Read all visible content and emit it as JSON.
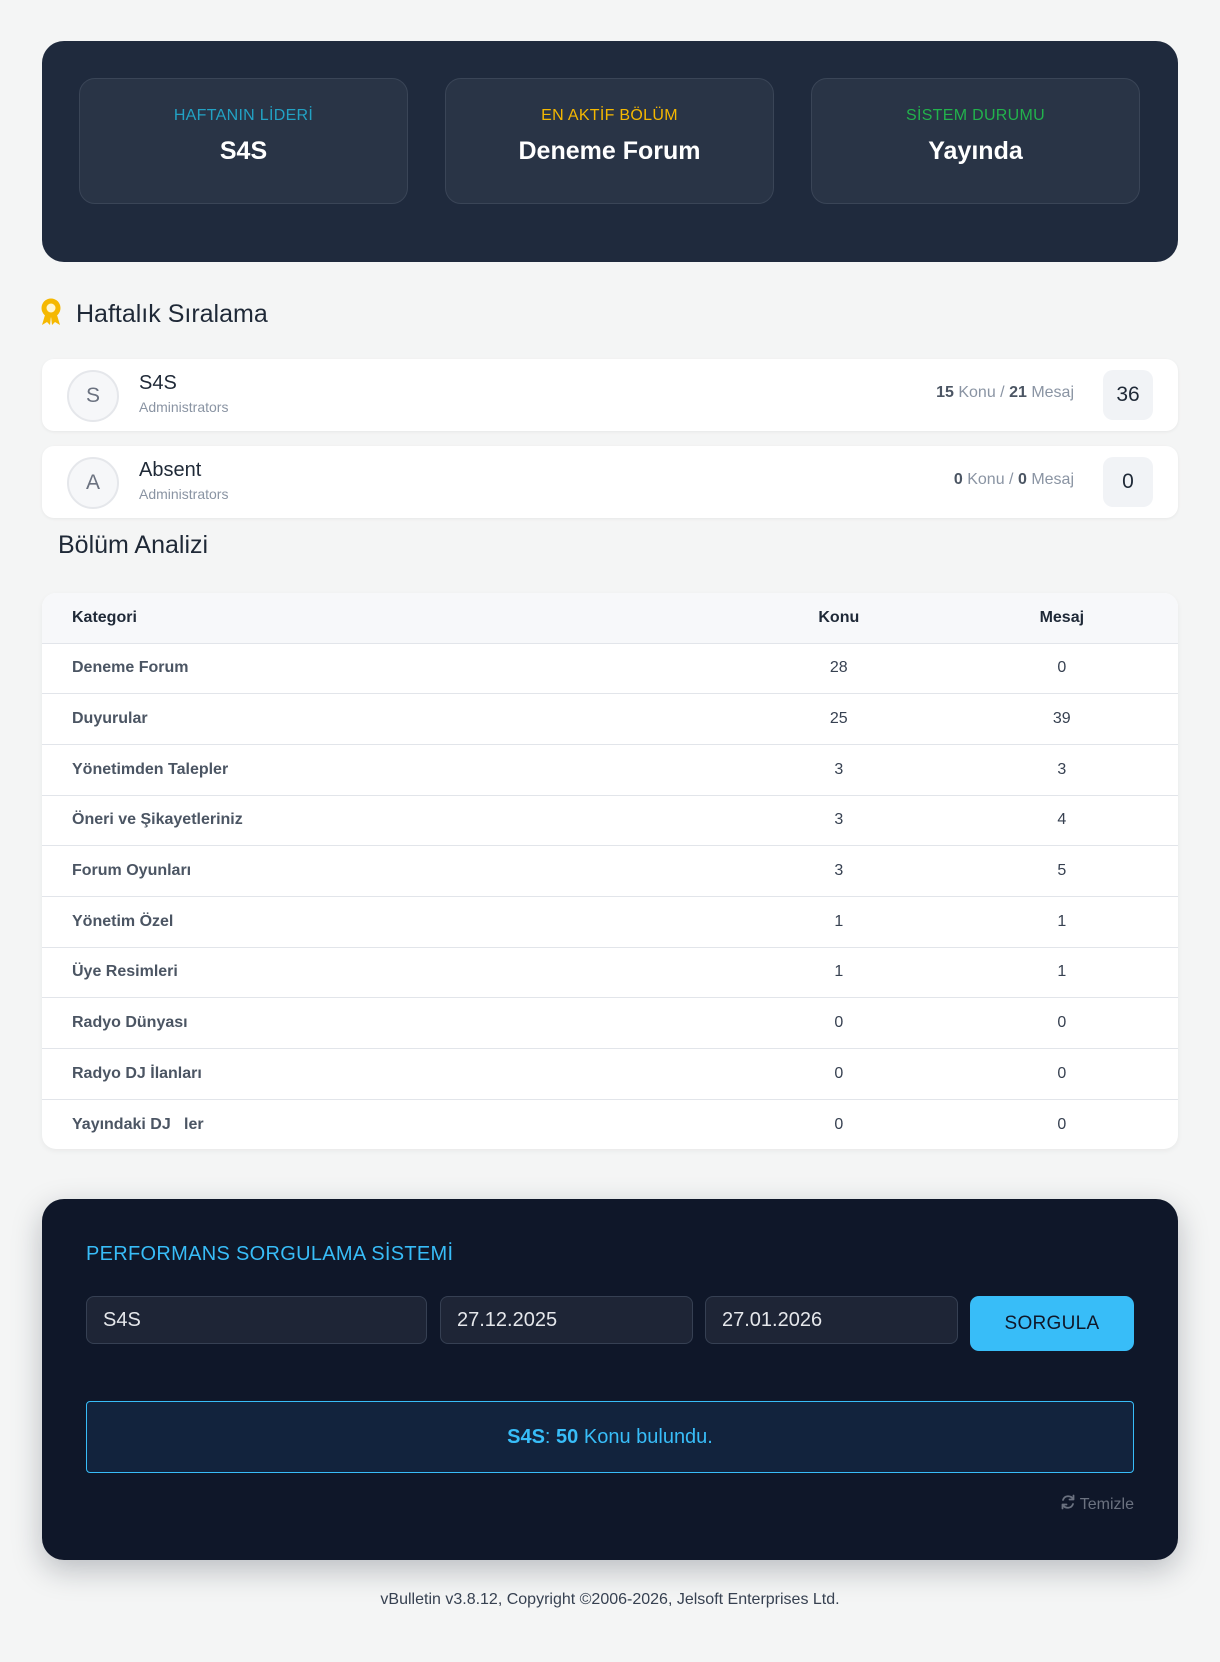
{
  "stats": [
    {
      "label": "HAFTANIN LİDERİ",
      "value": "S4S",
      "color": "#22a2c4"
    },
    {
      "label": "EN AKTİF BÖLÜM",
      "value": "Deneme Forum",
      "color": "#f5b800"
    },
    {
      "label": "SİSTEM DURUMU",
      "value": "Yayında",
      "color": "#22b24c"
    }
  ],
  "ranking": {
    "title": "Haftalık Sıralama",
    "icon": "award-ribbon-icon",
    "konu_label": "Konu",
    "mesaj_label": "Mesaj",
    "users": [
      {
        "initial": "S",
        "name": "S4S",
        "group": "Administrators",
        "konu": "15",
        "mesaj": "21",
        "score": "36"
      },
      {
        "initial": "A",
        "name": "Absent",
        "group": "Administrators",
        "konu": "0",
        "mesaj": "0",
        "score": "0"
      }
    ]
  },
  "analysis": {
    "title": "Bölüm Analizi",
    "headers": [
      "Kategori",
      "Konu",
      "Mesaj"
    ],
    "rows": [
      [
        "Deneme Forum",
        "28",
        "0"
      ],
      [
        "Duyurular",
        "25",
        "39"
      ],
      [
        "Yönetimden Talepler",
        "3",
        "3"
      ],
      [
        "Öneri ve Şikayetleriniz",
        "3",
        "4"
      ],
      [
        "Forum Oyunları",
        "3",
        "5"
      ],
      [
        "Yönetim Özel",
        "1",
        "1"
      ],
      [
        "Üye Resimleri",
        "1",
        "1"
      ],
      [
        "Radyo Dünyası",
        "0",
        "0"
      ],
      [
        "Radyo DJ İlanları",
        "0",
        "0"
      ],
      [
        "Yayındaki DJ   ler",
        "0",
        "0"
      ]
    ]
  },
  "performance": {
    "title": "PERFORMANS SORGULAMA SİSTEMİ",
    "username_value": "S4S",
    "start_date": "27.12.2025",
    "end_date": "27.01.2026",
    "button_label": "SORGULA",
    "result": {
      "user": "S4S",
      "separator": ":",
      "count": "50",
      "text": "Konu bulundu."
    },
    "clear_label": "Temizle",
    "clear_icon": "refresh-icon"
  },
  "footer": "vBulletin v3.8.12, Copyright ©2006-2026, Jelsoft Enterprises Ltd."
}
